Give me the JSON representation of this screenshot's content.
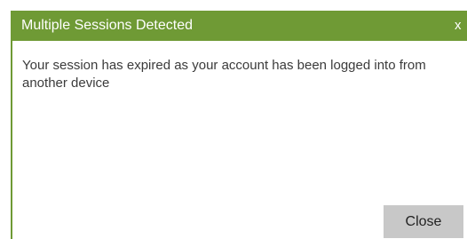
{
  "dialog": {
    "title": "Multiple Sessions Detected",
    "close_x": "x",
    "message": "Your session has expired as your account has been logged into from another device",
    "close_button_label": "Close"
  },
  "colors": {
    "title_bar": "#6f9a35",
    "title_text": "#ffffff",
    "button_background": "#c8c8c8",
    "message_text": "#3b3b3b"
  }
}
